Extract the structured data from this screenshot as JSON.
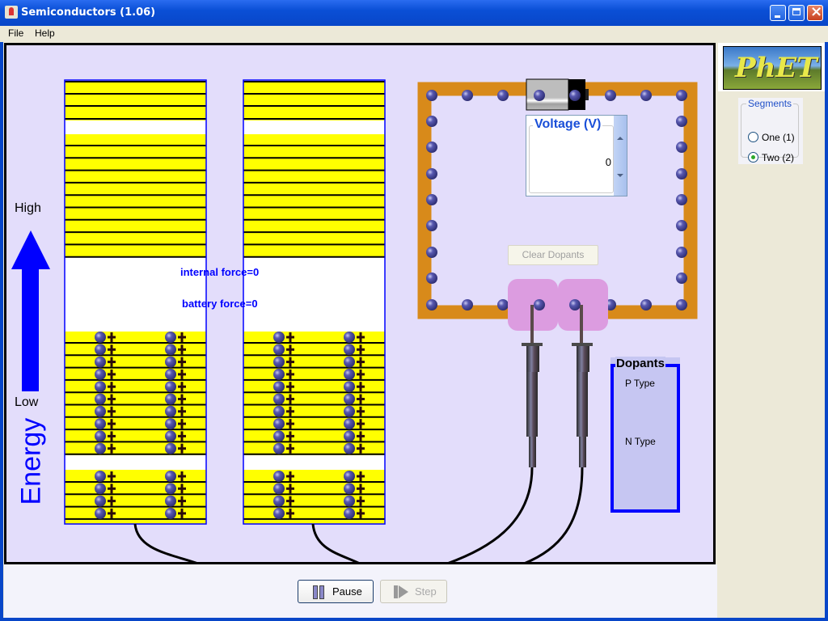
{
  "window": {
    "title": "Semiconductors (1.06)",
    "controls": [
      "minimize",
      "maximize",
      "close"
    ]
  },
  "menu": {
    "items": [
      {
        "label": "File"
      },
      {
        "label": "Help"
      }
    ]
  },
  "energy_axis": {
    "high_label": "High",
    "low_label": "Low",
    "axis_label": "Energy",
    "arrow_color": "#0000ff"
  },
  "forces": {
    "internal": "internal force=0",
    "battery": "battery force=0"
  },
  "voltage": {
    "label": "Voltage (V)",
    "value": "0"
  },
  "clear_dopants_label": "Clear Dopants",
  "dopants_panel": {
    "title": "Dopants",
    "p_type_label": "P Type",
    "n_type_label": "N Type",
    "p_color": "#d83a3a",
    "n_color": "#4caa4c"
  },
  "segments": {
    "title": "Segments",
    "options": [
      {
        "label": "One (1)",
        "selected": false
      },
      {
        "label": "Two (2)",
        "selected": true
      }
    ]
  },
  "controls": {
    "pause_label": "Pause",
    "step_label": "Step",
    "step_enabled": false
  },
  "logo": {
    "text": "PhET"
  },
  "colors": {
    "band_fill": "#ffff00",
    "gap_fill": "#ffffff",
    "circuit_wire": "#d88a1a",
    "electron": "#4a4aa0",
    "sim_background": "#e3ddfb",
    "probe_pad": "#dc9ce0"
  }
}
